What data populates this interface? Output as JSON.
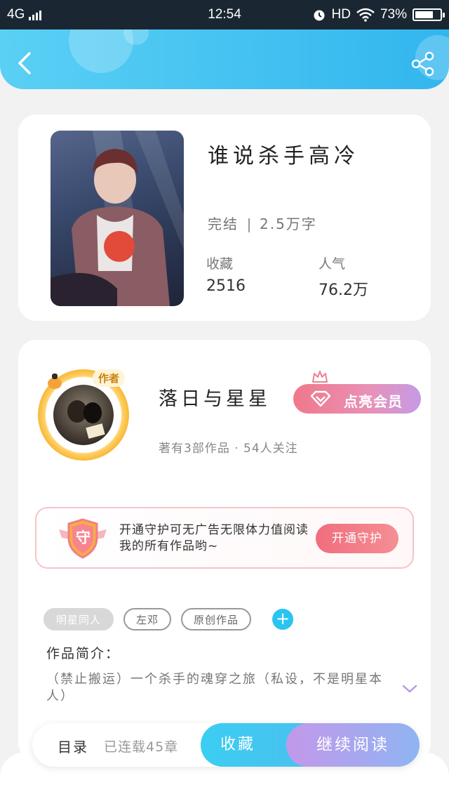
{
  "status_bar": {
    "network": "4G",
    "time": "12:54",
    "hd": "HD",
    "battery_percent": "73%",
    "battery_level": 0.73
  },
  "header": {
    "back_icon": "chevron-left-icon",
    "share_icon": "share-icon",
    "accent_color": "#32b6ee"
  },
  "book": {
    "title": "谁说杀手高冷",
    "status": "完结",
    "word_count": "2.5万字",
    "favorites_label": "收藏",
    "favorites_value": "2516",
    "popularity_label": "人气",
    "popularity_value": "76.2万"
  },
  "author": {
    "tag": "作者",
    "name": "落日与星星",
    "info": "著有3部作品 · 54人关注",
    "member_button": "点亮会员"
  },
  "guard": {
    "shield_char": "守",
    "text": "开通守护可无广告无限体力值阅读我的所有作品哟~",
    "button": "开通守护"
  },
  "tags": [
    {
      "label": "明星同人",
      "active": true
    },
    {
      "label": "左邓",
      "active": false
    },
    {
      "label": "原创作品",
      "active": false
    }
  ],
  "tag_add": "+",
  "intro": {
    "label": "作品简介：",
    "text": "（禁止搬运）一个杀手的魂穿之旅（私设，不是明星本人）"
  },
  "bottom_bar": {
    "toc": "目录",
    "chapters": "已连载45章",
    "favorite": "收藏",
    "continue_reading": "继续阅读"
  }
}
